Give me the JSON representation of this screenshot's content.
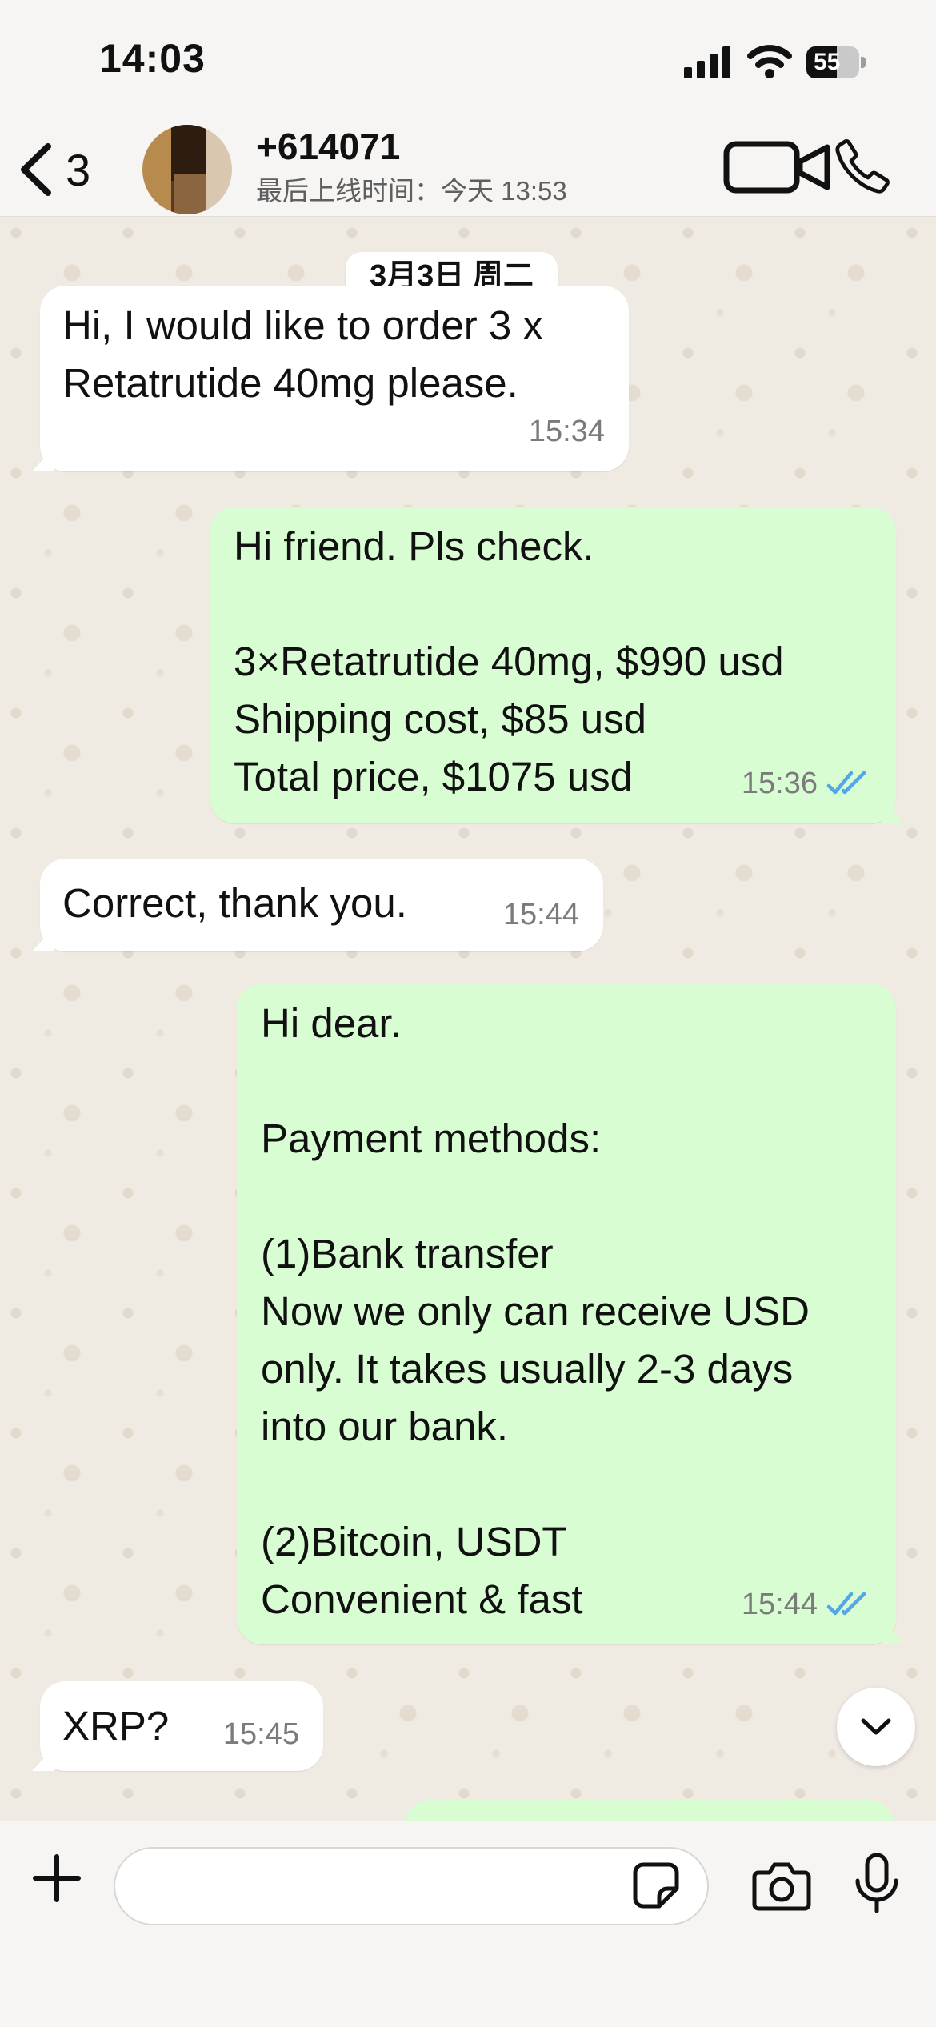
{
  "status_bar": {
    "time": "14:03",
    "battery_level": "55",
    "icons": [
      "cellular-signal-icon",
      "wifi-icon",
      "battery-icon"
    ]
  },
  "header": {
    "back_count": "3",
    "contact_name": "+614071",
    "last_seen": "最后上线时间：今天 13:53",
    "icons": [
      "back-chevron-icon",
      "video-call-icon",
      "phone-call-icon"
    ]
  },
  "chat": {
    "date_separator": "3月3日 周二",
    "messages": [
      {
        "direction": "incoming",
        "text": "Hi, I would like to order 3 x\nRetatrutide 40mg please.",
        "time": "15:34"
      },
      {
        "direction": "outgoing",
        "text": "Hi friend. Pls check.\n\n3×Retatrutide 40mg, $990 usd\nShipping cost, $85 usd\nTotal price, $1075 usd",
        "time": "15:36",
        "status": "read"
      },
      {
        "direction": "incoming",
        "text": "Correct, thank you.",
        "time": "15:44"
      },
      {
        "direction": "outgoing",
        "text": "Hi dear.\n\nPayment methods:\n\n(1)Bank transfer\nNow we only can receive USD\nonly. It takes usually 2-3 days\ninto our bank.\n\n(2)Bitcoin, USDT\nConvenient & fast",
        "time": "15:44",
        "status": "read"
      },
      {
        "direction": "incoming",
        "text": "XRP?",
        "time": "15:45"
      }
    ]
  },
  "input_bar": {
    "placeholder": "",
    "icons": [
      "plus-icon",
      "sticker-icon",
      "camera-icon",
      "microphone-icon"
    ]
  },
  "colors": {
    "incoming_bubble": "#ffffff",
    "outgoing_bubble": "#d9fdd3",
    "read_ticks": "#53a6e8",
    "chat_background": "#efeae2"
  }
}
